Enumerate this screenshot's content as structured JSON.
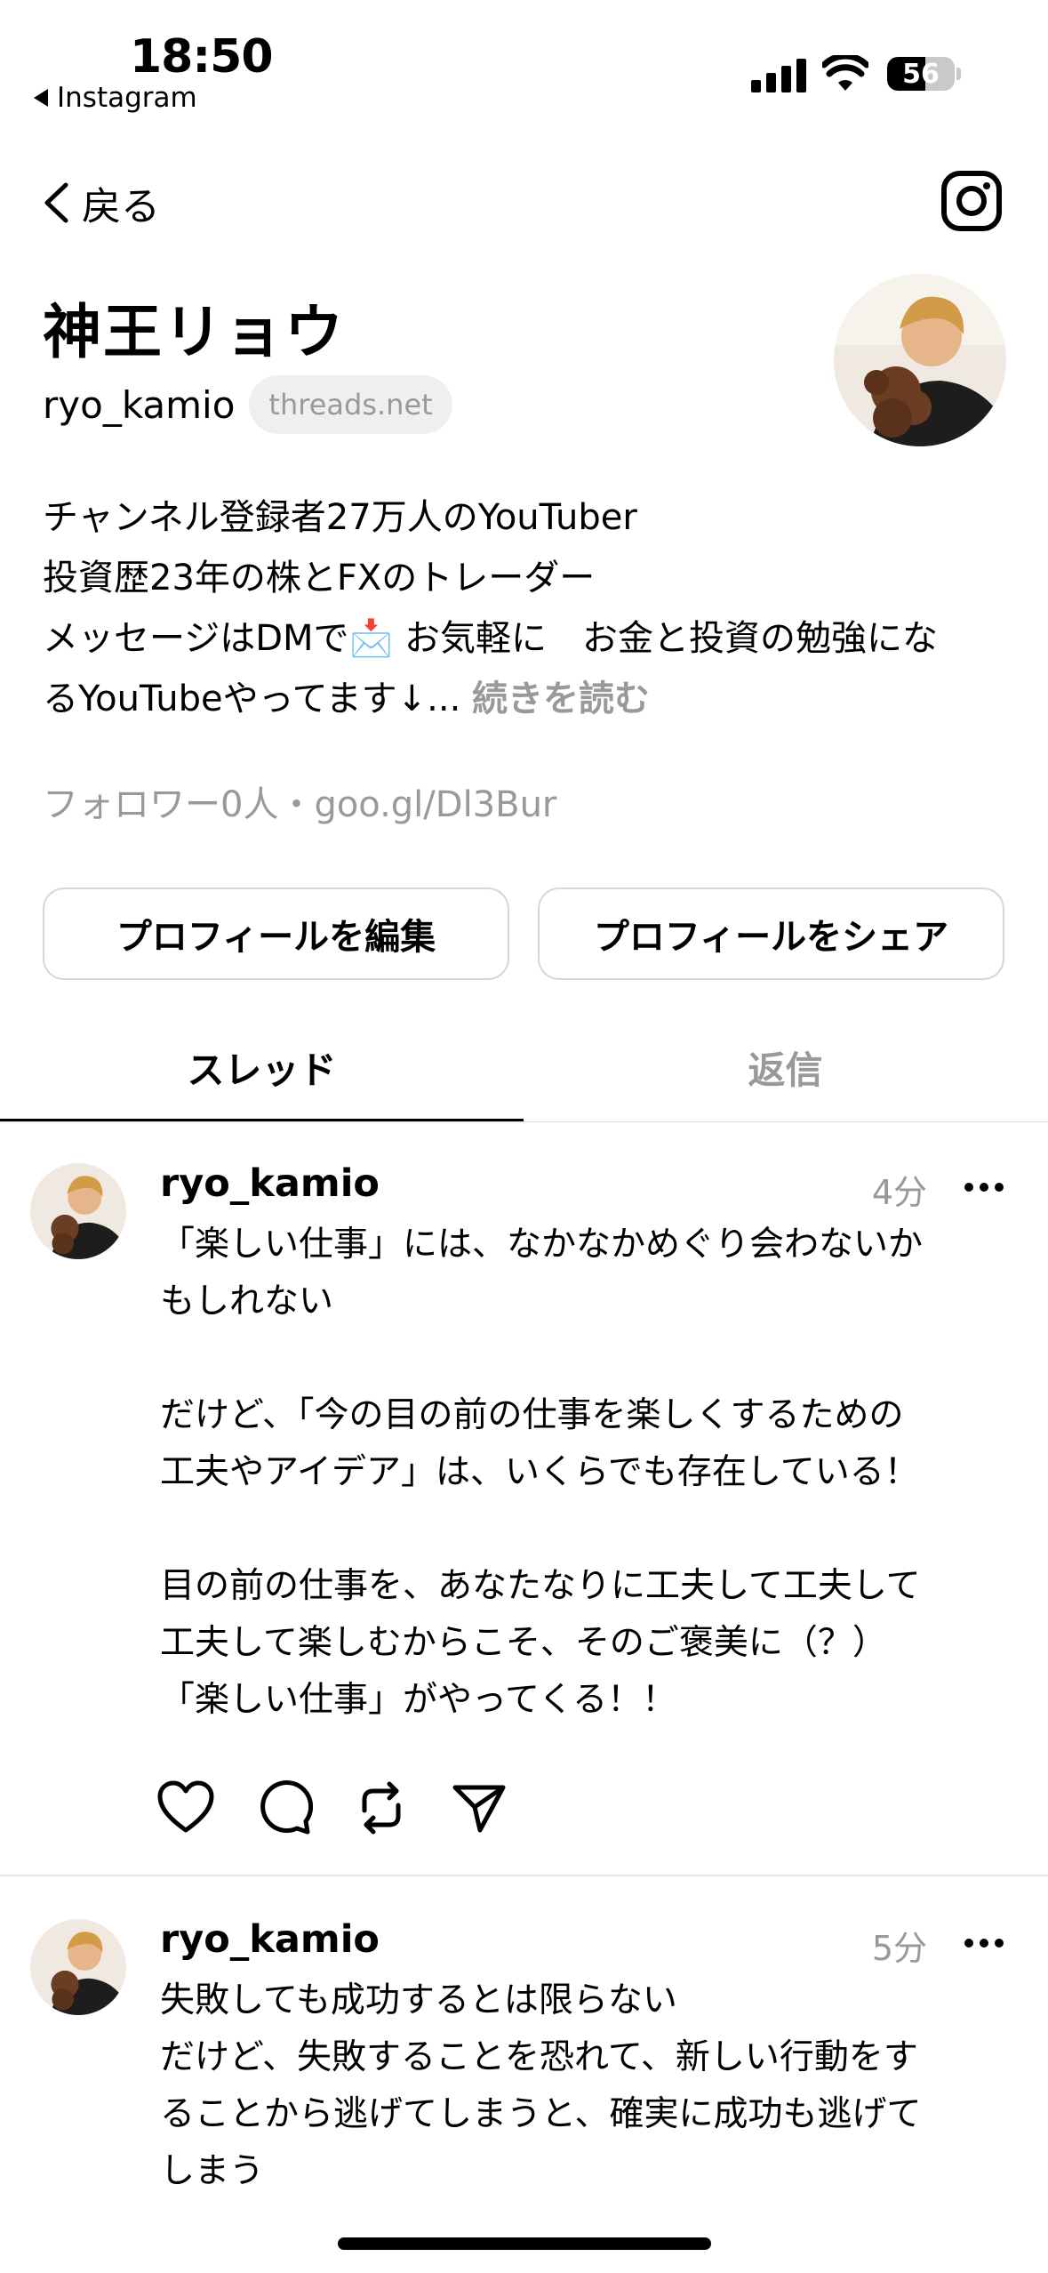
{
  "status_bar": {
    "time": "18:50",
    "back_app": "Instagram",
    "battery": "56",
    "battery_level": 0.56
  },
  "nav": {
    "back_label": "戻る"
  },
  "profile": {
    "name": "神王リョウ",
    "handle": "ryo_kamio",
    "threads_chip": "threads.net",
    "bio_lines": [
      "チャンネル登録者27万人のYouTuber",
      "投資歴23年の株とFXのトレーダー",
      "メッセージはDMで📩 お気軽に　お金と投資の勉強にな",
      "るYouTubeやってます↓..."
    ],
    "read_more": "続きを読む",
    "followers_line": "フォロワー0人・goo.gl/Dl3Bur"
  },
  "buttons": {
    "edit_profile": "プロフィールを編集",
    "share_profile": "プロフィールをシェア"
  },
  "tabs": [
    {
      "label": "スレッド",
      "active": true
    },
    {
      "label": "返信",
      "active": false
    }
  ],
  "posts": [
    {
      "user": "ryo_kamio",
      "time": "4分",
      "text": "「楽しい仕事」には、なかなかめぐり会わないか\nもしれない\n\nだけど、「今の目の前の仕事を楽しくするための\n工夫やアイデア」は、いくらでも存在している！\n\n目の前の仕事を、あなたなりに工夫して工夫して\n工夫して楽しむからこそ、そのご褒美に（？）\n「楽しい仕事」がやってくる！！"
    },
    {
      "user": "ryo_kamio",
      "time": "5分",
      "text": "失敗しても成功するとは限らない\nだけど、失敗することを恐れて、新しい行動をす\nることから逃げてしまうと、確実に成功も逃げて\nしまう"
    }
  ],
  "colors": {
    "text": "#000000",
    "muted": "#999999",
    "chip_bg": "#efefef",
    "border": "#d7d7d7"
  }
}
